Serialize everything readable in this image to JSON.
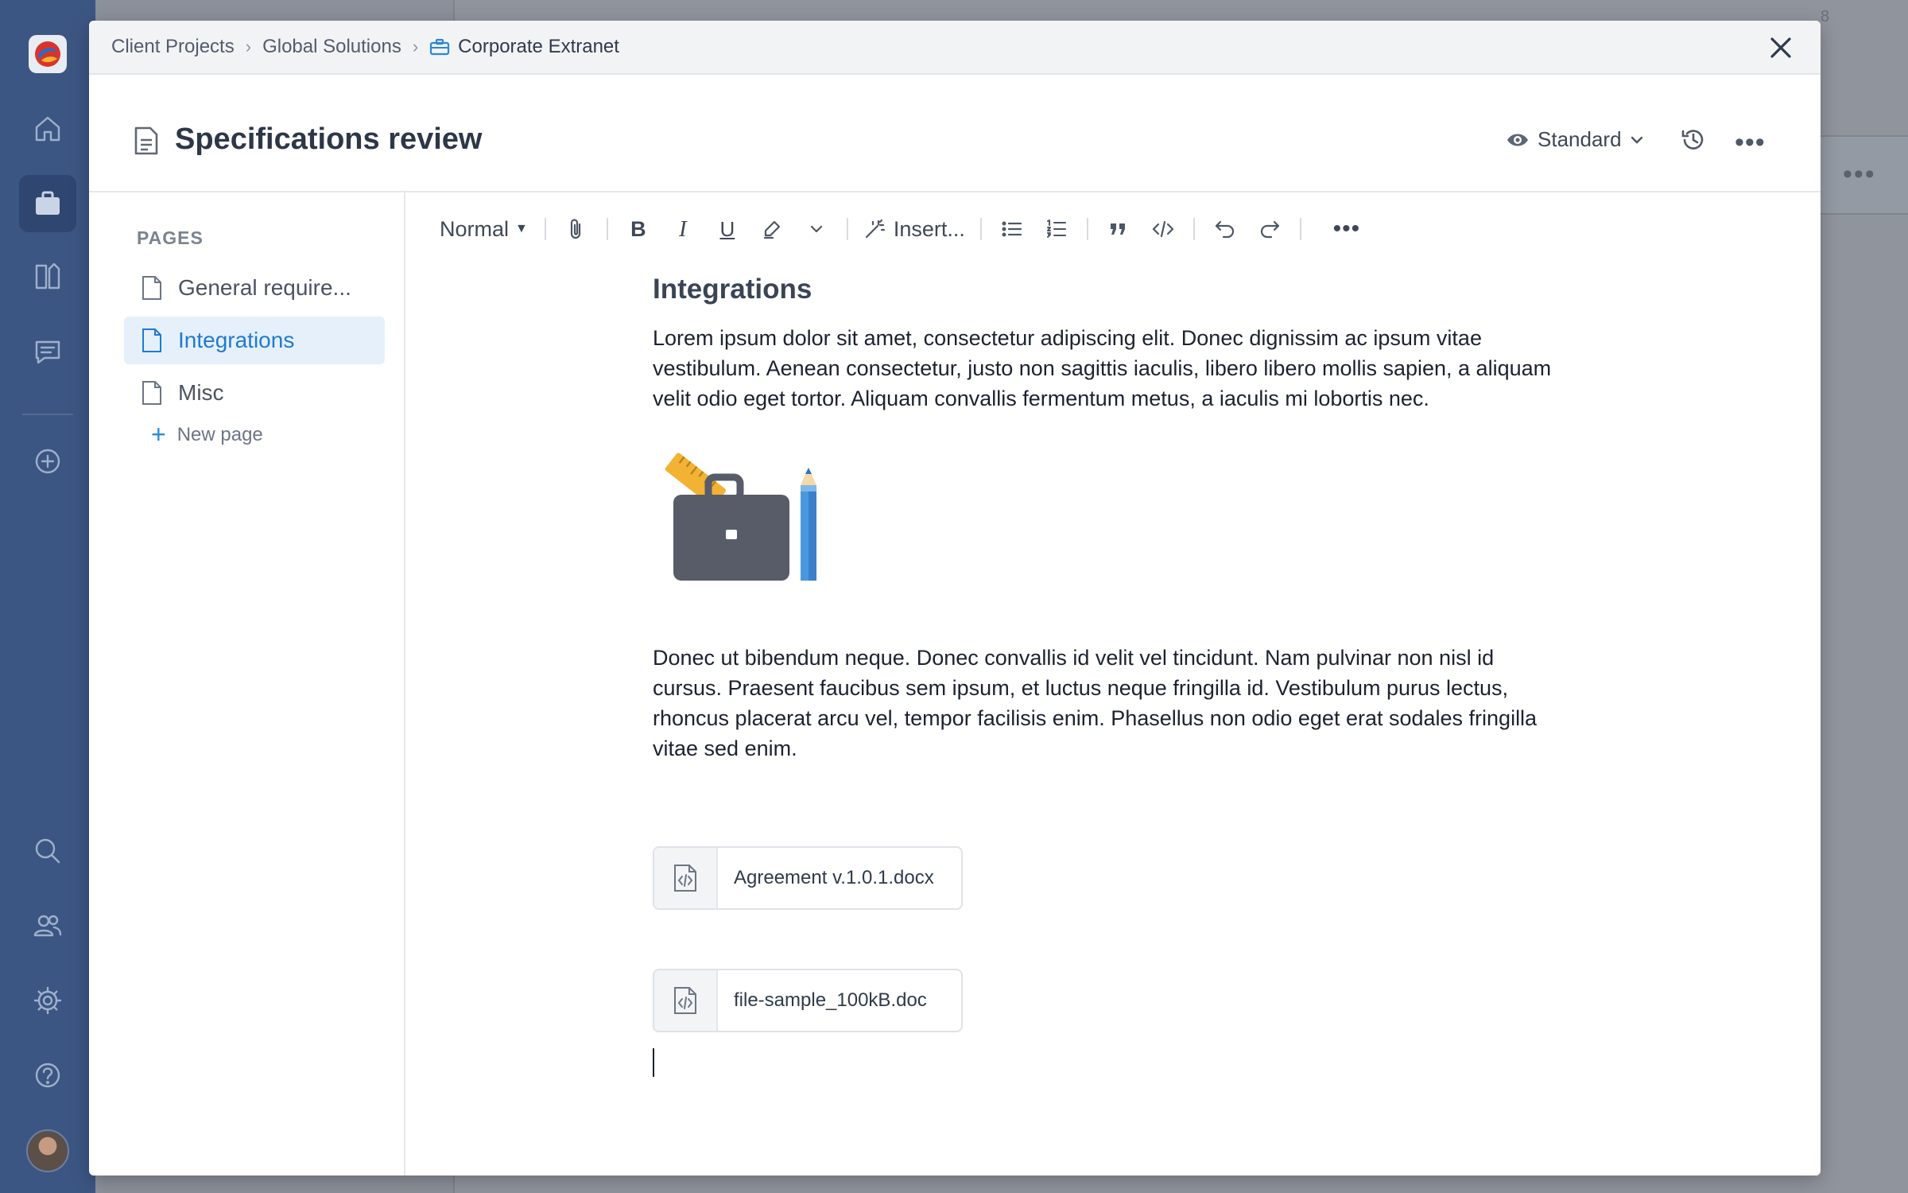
{
  "rail": {
    "nav": [
      "home-icon",
      "briefcase-icon",
      "tools-icon",
      "chat-icon",
      "add-icon"
    ],
    "bottom": [
      "search-icon",
      "people-icon",
      "gear-icon",
      "help-icon"
    ],
    "active": "briefcase-icon"
  },
  "background": {
    "badge_count": "8"
  },
  "breadcrumb": {
    "items": [
      "Client Projects",
      "Global Solutions",
      "Corporate Extranet"
    ],
    "current_icon": "briefcase-icon"
  },
  "header": {
    "title": "Specifications review",
    "view_mode": "Standard"
  },
  "sidebar": {
    "heading": "PAGES",
    "pages": [
      "General require...",
      "Integrations",
      "Misc"
    ],
    "selected_index": 1,
    "new_page_label": "New page"
  },
  "toolbar": {
    "block_style": "Normal",
    "insert_label": "Insert..."
  },
  "document": {
    "heading": "Integrations",
    "paragraph1": "Lorem ipsum dolor sit amet, consectetur adipiscing elit. Donec dignissim ac ipsum vitae vestibulum. Aenean consectetur, justo non sagittis iaculis, libero libero mollis sapien, a aliquam velit odio eget tortor. Aliquam convallis fermentum metus, a iaculis mi lobortis nec.",
    "paragraph2": "Donec ut bibendum neque. Donec convallis id velit vel tincidunt. Nam pulvinar non nisl id cursus. Praesent faucibus sem ipsum, et luctus neque fringilla id. Vestibulum purus lectus, rhoncus placerat arcu vel, tempor facilisis enim. Phasellus non odio eget erat sodales fringilla vitae sed enim.",
    "attachments": [
      "Agreement v.1.0.1.docx",
      "file-sample_100kB.doc"
    ]
  },
  "colors": {
    "rail": "#3c5683",
    "accent": "#1f7bd0",
    "selected_bg": "#e6f0fb"
  }
}
